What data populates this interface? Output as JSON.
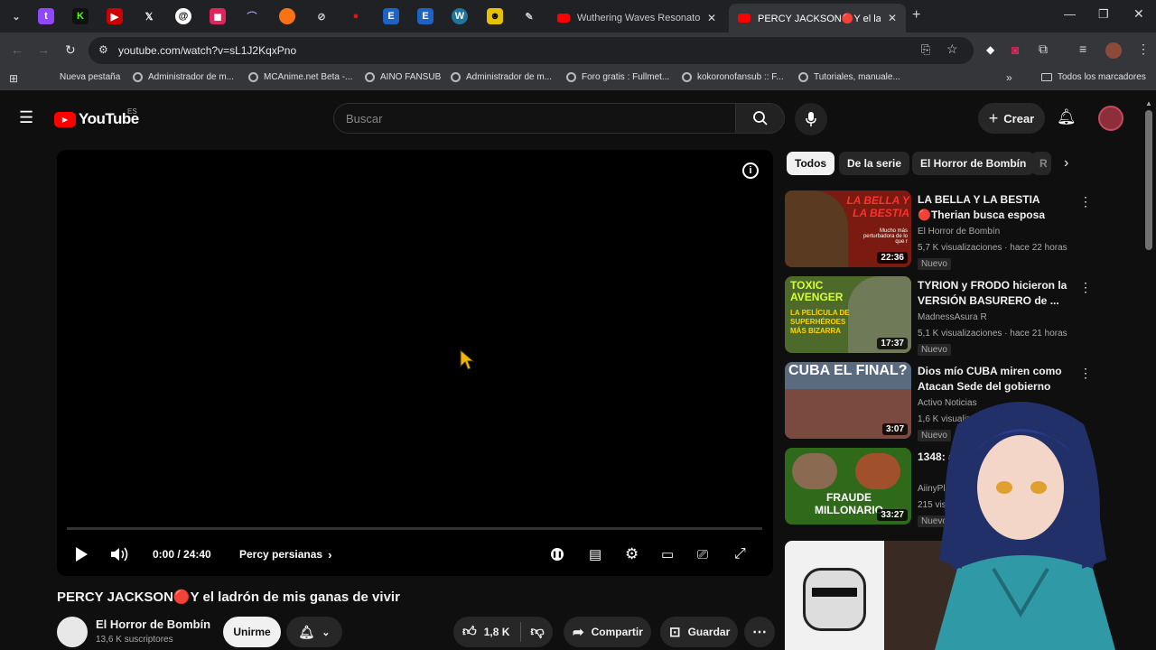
{
  "browser": {
    "tabs": [
      {
        "title": "Wuthering Waves Resonator Co",
        "active": false
      },
      {
        "title": "PERCY JACKSON🔴Y el ladrón d",
        "active": true
      }
    ],
    "url": "youtube.com/watch?v=sL1J2KqxPno",
    "bookmarks": [
      "Nueva pestaña",
      "Administrador de m...",
      "MCAnime.net Beta -...",
      "AINO FANSUB",
      "Administrador de m...",
      "Foro gratis : Fullmet...",
      "kokoronofansub :: F...",
      "Tutoriales, manuale..."
    ],
    "all_bookmarks": "Todos los marcadores"
  },
  "header": {
    "logo": "YouTube",
    "region": "ES",
    "search_placeholder": "Buscar",
    "create_label": "Crear"
  },
  "player": {
    "time": "0:00 / 24:40",
    "chapter": "Percy persianas",
    "progress": 0
  },
  "video": {
    "title": "PERCY JACKSON🔴Y el ladrón de mis ganas de vivir",
    "channel": "El Horror de Bombín",
    "subscribers": "13,6 K suscriptores",
    "join_label": "Unirme",
    "likes": "1,8 K",
    "share_label": "Compartir",
    "save_label": "Guardar"
  },
  "chips": [
    "Todos",
    "De la serie",
    "El Horror de Bombín",
    "R"
  ],
  "recommended": [
    {
      "title": "LA BELLA Y LA BESTIA 🔴Therian busca esposa",
      "channel": "El Horror de Bombín",
      "meta": "5,7 K visualizaciones · hace 22 horas",
      "badge": "Nuevo",
      "duration": "22:36",
      "thumb_text": "LA BELLA Y LA BESTIA",
      "thumb_sub": "Mucho más perturbadora de lo que r",
      "thumb_color": "#7a1a10"
    },
    {
      "title": "TYRION y FRODO hicieron la VERSIÓN BASURERO de ...",
      "channel": "MadnessAsura R",
      "meta": "5,1 K visualizaciones · hace 21 horas",
      "badge": "Nuevo",
      "duration": "17:37",
      "thumb_text": "TOXIC AVENGER",
      "thumb_sub": "LA PELÍCULA DE SUPERHÉROES MÁS BIZARRA",
      "thumb_color": "#4d6a2a"
    },
    {
      "title": "Dios mío CUBA miren como Atacan Sede del gobierno",
      "channel": "Activo Noticias",
      "meta": "1,6 K visualiz",
      "badge": "Nuevo",
      "duration": "3:07",
      "thumb_text": "CUBA EL FINAL?",
      "thumb_sub": "",
      "thumb_color": "#5a6a80"
    },
    {
      "title": "1348: al Gob",
      "channel": "AiinyPla",
      "meta": "215 visu",
      "badge": "Nuevo",
      "duration": "33:27",
      "thumb_text": "FRAUDE MILLONARIO",
      "thumb_sub": "",
      "thumb_color": "#2f6a1a"
    }
  ]
}
